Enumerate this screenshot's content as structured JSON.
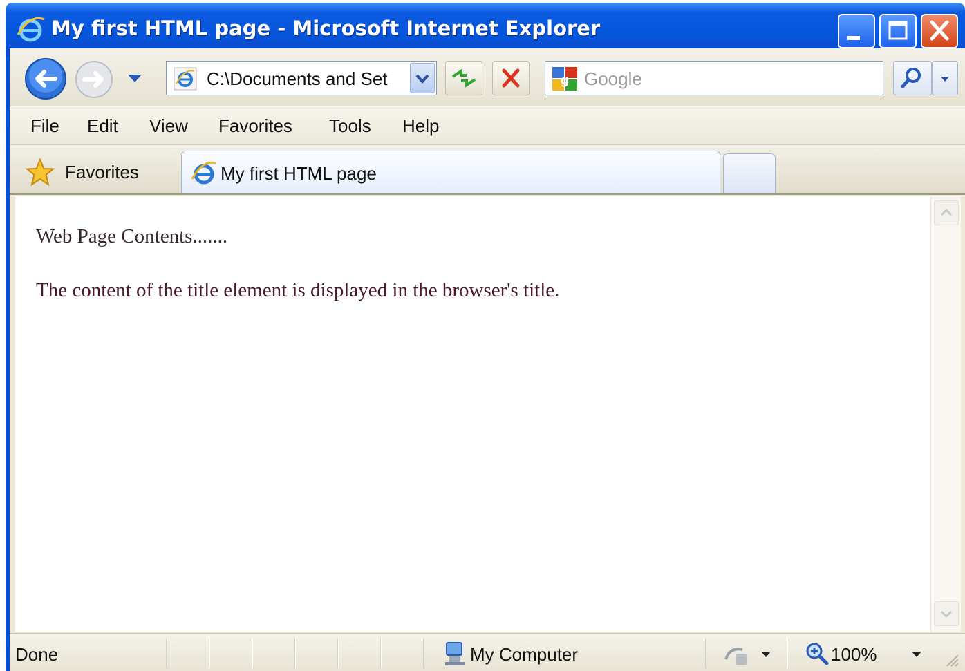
{
  "window": {
    "title": "My first HTML page - Microsoft Internet Explorer"
  },
  "navbar": {
    "address": "C:\\Documents and Set",
    "search_placeholder": "Google"
  },
  "menu": {
    "items": [
      "File",
      "Edit",
      "View",
      "Favorites",
      "Tools",
      "Help"
    ]
  },
  "tabs": {
    "favorites_label": "Favorites",
    "active_tab_label": "My first HTML page"
  },
  "page": {
    "line1": "Web Page Contents.......",
    "line2": "The content of the title element is displayed in the browser's title."
  },
  "status": {
    "left": "Done",
    "zone": "My Computer",
    "zoom": "100%"
  },
  "colors": {
    "titlebar": "#0656dc",
    "chrome": "#ece9d8",
    "close_button": "#d24418"
  },
  "icons": [
    "ie-icon",
    "back-icon",
    "forward-icon",
    "refresh-icon",
    "stop-icon",
    "google-icon",
    "search-icon",
    "star-icon",
    "computer-icon",
    "zoom-icon",
    "security-icon"
  ]
}
